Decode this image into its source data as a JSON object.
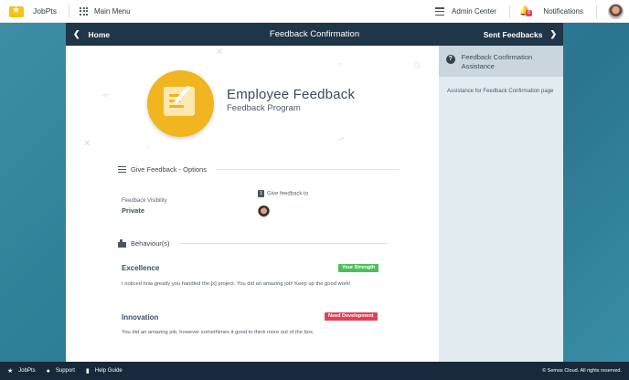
{
  "topbar": {
    "brand": "JobPts",
    "main_menu": "Main Menu",
    "admin_center": "Admin Center",
    "notifications": "Notifications",
    "notification_count": "8"
  },
  "navbar": {
    "back": "Home",
    "title": "Feedback Confirmation",
    "forward": "Sent Feedbacks"
  },
  "header": {
    "title": "Employee Feedback",
    "subtitle": "Feedback Program"
  },
  "options": {
    "heading": "Give Feedback - Options",
    "visibility_label": "Feedback Visibility",
    "visibility_value": "Private",
    "recipients_count": "1",
    "recipients_label": "Give feedback to"
  },
  "behaviours": {
    "heading": "Behaviour(s)",
    "items": [
      {
        "name": "Excellence",
        "tag": "Your Strength",
        "tag_color": "#4cbf5a",
        "text": "I noticed how greatly you handled the [x] project. You did an amazing job! Keep up the good work!"
      },
      {
        "name": "Innovation",
        "tag": "Need Development",
        "tag_color": "#e0415a",
        "text": "You did an amazing job, however somethimes it good to think more out of the box."
      }
    ]
  },
  "assistance": {
    "title": "Feedback Confirmation Assistance",
    "body": "Assistance for Feedback Confirmation page"
  },
  "footer": {
    "brand": "JobPts",
    "support": "Support",
    "help": "Help Guide",
    "copyright": "© Semos Cloud. All rights reserved."
  }
}
